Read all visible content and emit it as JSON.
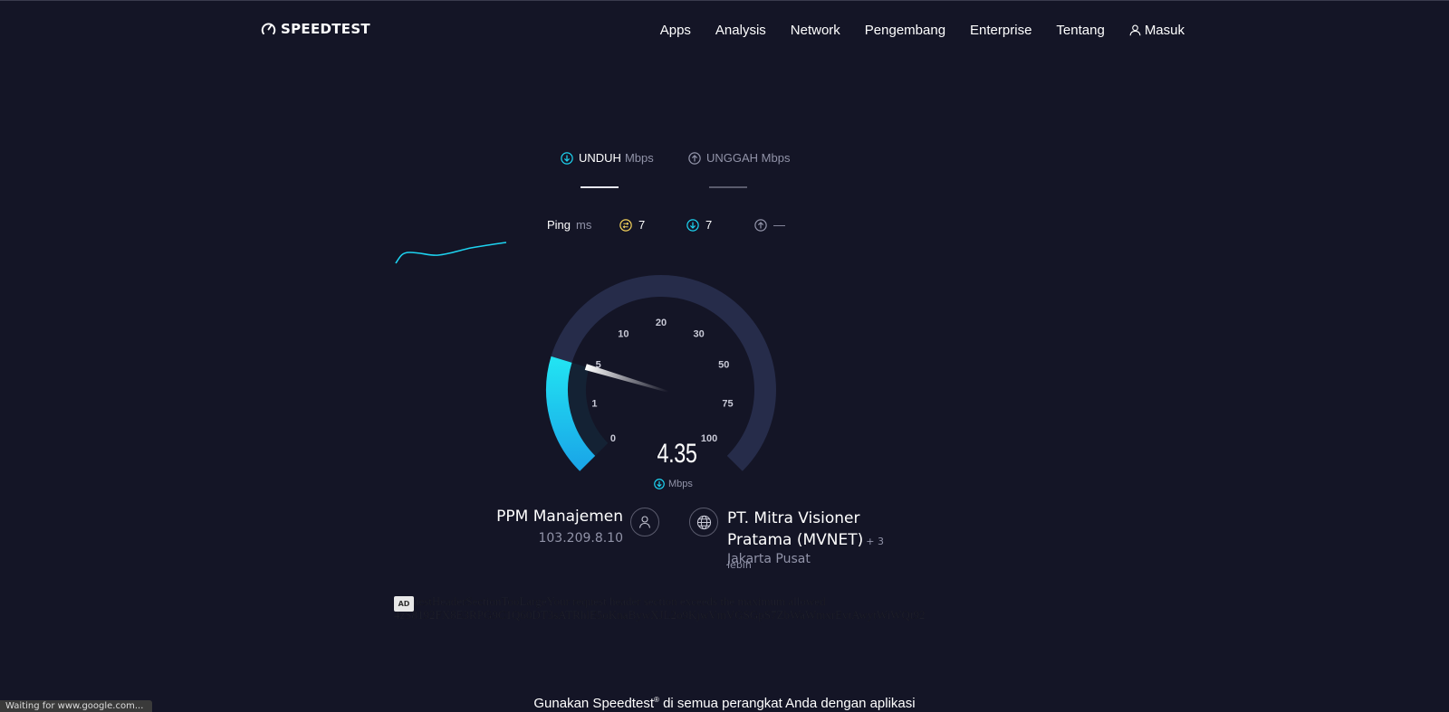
{
  "header": {
    "logo": "SPEEDTEST",
    "nav": [
      "Apps",
      "Analysis",
      "Network",
      "Pengembang",
      "Enterprise",
      "Tentang"
    ],
    "signin": "Masuk"
  },
  "tabs": {
    "download_label": "UNDUH",
    "download_unit": "Mbps",
    "upload_label": "UNGGAH Mbps"
  },
  "ping": {
    "label": "Ping",
    "unit": "ms",
    "idle": "7",
    "download": "7",
    "upload": "—"
  },
  "gauge": {
    "value": "4.35",
    "unit": "Mbps",
    "ticks": [
      "0",
      "1",
      "5",
      "10",
      "20",
      "30",
      "50",
      "75",
      "100"
    ],
    "current_mbps": 4.35,
    "colors": {
      "track": "#262c4a",
      "fill": "#1dd3f0",
      "needle": "#ffffff"
    }
  },
  "client": {
    "name": "PPM Manajemen",
    "ip": "103.209.8.10"
  },
  "server": {
    "name": "PT. Mitra Visioner Pratama (MVNET)",
    "more": "+ 3 lebih",
    "location": "Jakarta Pusat"
  },
  "ad": {
    "badge": "AD",
    "line1": "RequestHeaderSectionTooLargeYour request header section exceeds the maximum allowed",
    "line2": "4zS8192FX8E3RPG9C1Q60DT3sATRhlE5oKnaBywXJL2o9KjwVmVGSGpS7ZbWaWmxrEvtAwytWiWQt92"
  },
  "footer": {
    "text_before": "Gunakan Speedtest",
    "sup": "®",
    "text_after": " di semua perangkat Anda dengan aplikasi"
  },
  "status_bar": "Waiting for www.google.com..."
}
